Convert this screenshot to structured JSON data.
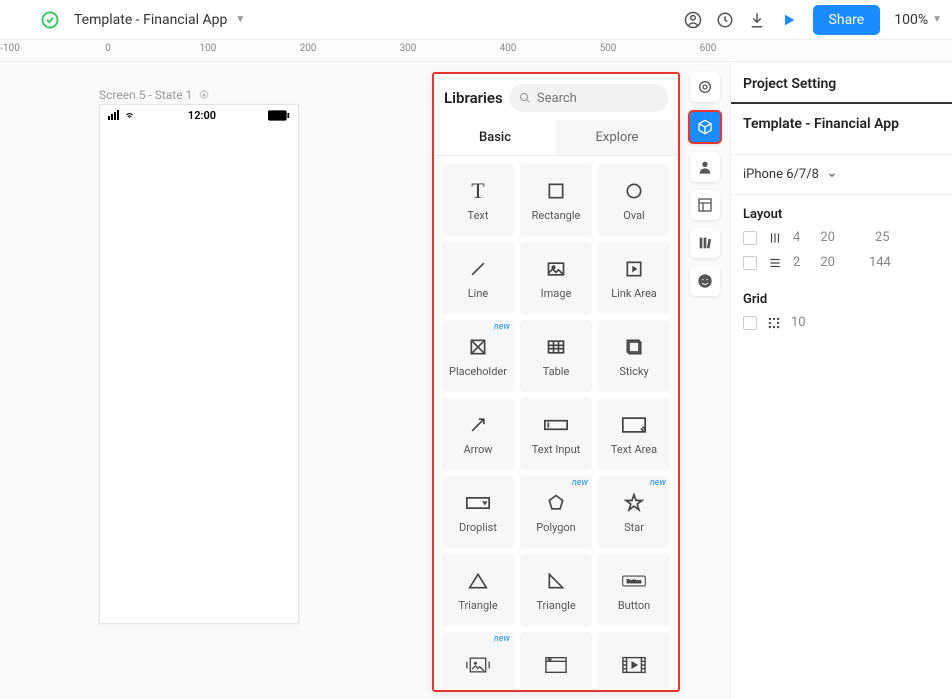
{
  "topbar": {
    "title": "Template - Financial App",
    "share_label": "Share",
    "zoom": "100%"
  },
  "ruler": {
    "ticks": [
      "-100",
      "0",
      "100",
      "200",
      "300",
      "400",
      "500",
      "600"
    ]
  },
  "canvas": {
    "screen_label": "Screen 5 - State 1",
    "phone_time": "12:00"
  },
  "libraries": {
    "title": "Libraries",
    "search_placeholder": "Search",
    "tabs": {
      "basic": "Basic",
      "explore": "Explore"
    },
    "items": [
      {
        "label": "Text",
        "icon": "text"
      },
      {
        "label": "Rectangle",
        "icon": "rect"
      },
      {
        "label": "Oval",
        "icon": "oval"
      },
      {
        "label": "Line",
        "icon": "line"
      },
      {
        "label": "Image",
        "icon": "image"
      },
      {
        "label": "Link Area",
        "icon": "linkarea"
      },
      {
        "label": "Placeholder",
        "icon": "placeholder",
        "badge": "new"
      },
      {
        "label": "Table",
        "icon": "table"
      },
      {
        "label": "Sticky",
        "icon": "sticky"
      },
      {
        "label": "Arrow",
        "icon": "arrow"
      },
      {
        "label": "Text Input",
        "icon": "textinput"
      },
      {
        "label": "Text Area",
        "icon": "textarea"
      },
      {
        "label": "Droplist",
        "icon": "droplist"
      },
      {
        "label": "Polygon",
        "icon": "polygon",
        "badge": "new"
      },
      {
        "label": "Star",
        "icon": "star",
        "badge": "new"
      },
      {
        "label": "Triangle",
        "icon": "triangle"
      },
      {
        "label": "Triangle",
        "icon": "rtriangle"
      },
      {
        "label": "Button",
        "icon": "button"
      },
      {
        "label": "",
        "icon": "carousel",
        "badge": "new"
      },
      {
        "label": "",
        "icon": "browser"
      },
      {
        "label": "",
        "icon": "video"
      }
    ]
  },
  "rail": {
    "items": [
      "target",
      "cube",
      "person",
      "layout",
      "library",
      "smile"
    ]
  },
  "inspector": {
    "head": "Project Setting",
    "project_name": "Template - Financial App",
    "device": "iPhone 6/7/8",
    "layout_label": "Layout",
    "layout_rows": [
      {
        "v1": "4",
        "v2": "20",
        "v3": "25"
      },
      {
        "v1": "2",
        "v2": "20",
        "v3": "144"
      }
    ],
    "grid_label": "Grid",
    "grid_value": "10"
  }
}
